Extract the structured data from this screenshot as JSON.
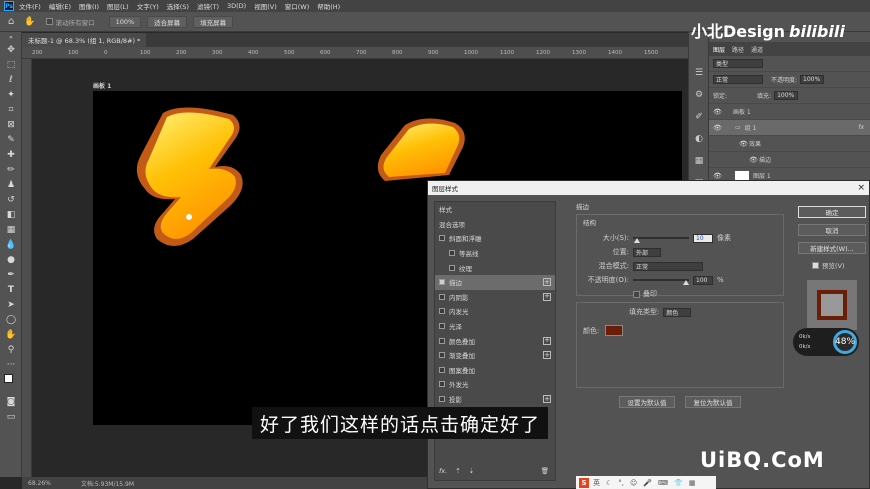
{
  "menubar": {
    "logo": "Ps",
    "items": [
      "文件(F)",
      "编辑(E)",
      "图像(I)",
      "图层(L)",
      "文字(Y)",
      "选择(S)",
      "滤镜(T)",
      "3D(D)",
      "视图(V)",
      "窗口(W)",
      "帮助(H)"
    ]
  },
  "optbar": {
    "scroll_all": "滚动所有窗口",
    "zoom": "100%",
    "fit_screen": "适合屏幕",
    "fill_screen": "填充屏幕"
  },
  "document": {
    "tab_title": "未标题-1 @ 68.3% (组 1, RGB/8#) *",
    "artboard_label": "画板 1",
    "ruler_ticks": [
      "200",
      "100",
      "0",
      "100",
      "200",
      "300",
      "400",
      "500",
      "600",
      "700",
      "800",
      "900",
      "1000",
      "1100",
      "1200",
      "1300",
      "1400",
      "1500"
    ]
  },
  "statusbar": {
    "zoom": "68.26%",
    "doc_info": "文档:5.93M/15.9M"
  },
  "watermark": {
    "text": "小北Design",
    "bili": "bilibili"
  },
  "layers": {
    "tabs": [
      "图层",
      "路径",
      "通道"
    ],
    "kind": "类型",
    "blend": "正常",
    "opacity_label": "不透明度:",
    "opacity": "100%",
    "lock_label": "锁定:",
    "fill_label": "填充:",
    "fill": "100%",
    "rows": [
      {
        "name": "画板 1",
        "indent": 0
      },
      {
        "name": "组 1",
        "indent": 1,
        "fx": "fx"
      },
      {
        "name": "效果",
        "indent": 2
      },
      {
        "name": "描边",
        "indent": 3
      },
      {
        "name": "图层 1",
        "indent": 1
      }
    ]
  },
  "dialog": {
    "title": "图层样式",
    "close": "×",
    "styles_header": "样式",
    "blend_options": "混合选项",
    "style_items": [
      {
        "label": "斜面和浮雕",
        "checked": false,
        "sub": false,
        "plus": false
      },
      {
        "label": "等高线",
        "checked": false,
        "sub": true,
        "plus": false
      },
      {
        "label": "纹理",
        "checked": false,
        "sub": true,
        "plus": false
      },
      {
        "label": "描边",
        "checked": true,
        "sub": false,
        "plus": true,
        "active": true
      },
      {
        "label": "内阴影",
        "checked": false,
        "sub": false,
        "plus": true
      },
      {
        "label": "内发光",
        "checked": false,
        "sub": false,
        "plus": false
      },
      {
        "label": "光泽",
        "checked": false,
        "sub": false,
        "plus": false
      },
      {
        "label": "颜色叠加",
        "checked": false,
        "sub": false,
        "plus": true
      },
      {
        "label": "渐变叠加",
        "checked": false,
        "sub": false,
        "plus": true
      },
      {
        "label": "图案叠加",
        "checked": false,
        "sub": false,
        "plus": false
      },
      {
        "label": "外发光",
        "checked": false,
        "sub": false,
        "plus": false
      },
      {
        "label": "投影",
        "checked": false,
        "sub": false,
        "plus": true
      }
    ],
    "fx_label": "fx.",
    "stroke": {
      "section": "描边",
      "structure": "结构",
      "size_label": "大小(S):",
      "size_value": "10",
      "size_unit": "像素",
      "position_label": "位置:",
      "position_value": "外部",
      "blend_label": "混合模式:",
      "blend_value": "正常",
      "opacity_label": "不透明度(O):",
      "opacity_value": "100",
      "opacity_unit": "%",
      "overprint": "叠印",
      "fill_type_label": "填充类型:",
      "fill_type_value": "颜色",
      "color_label": "颜色:",
      "color": "#6b1d08",
      "set_default": "设置为默认值",
      "reset_default": "复位为默认值"
    },
    "buttons": {
      "ok": "确定",
      "cancel": "取消",
      "new_style": "新建样式(W)...",
      "preview": "预览(V)"
    }
  },
  "perf": {
    "up": "0k/s",
    "down": "0k/s",
    "percent": "48%"
  },
  "subtitle": "好了我们这样的话点击确定好了",
  "site_watermark": "UiBQ.CoM",
  "ime": {
    "logo": "S",
    "lang": "英"
  }
}
